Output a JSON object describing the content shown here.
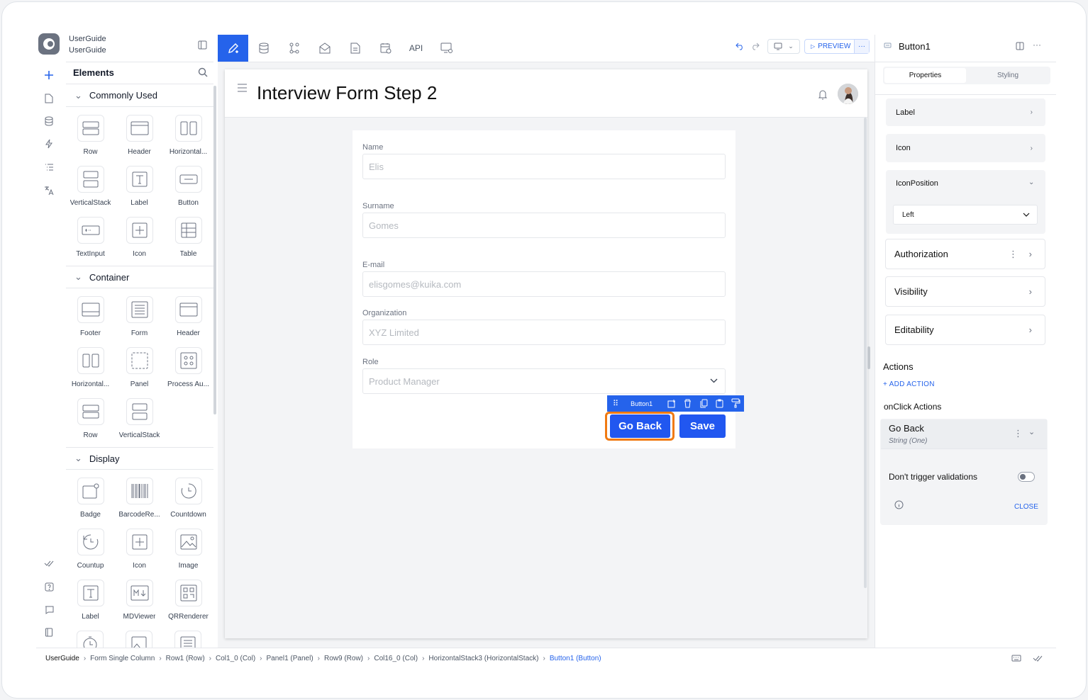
{
  "app": {
    "name_line1": "UserGuide",
    "name_line2": "UserGuide"
  },
  "toolbar": {
    "api_label": "API",
    "preview_label": "PREVIEW"
  },
  "elements_panel": {
    "title": "Elements",
    "sections": [
      {
        "label": "Commonly Used",
        "items": [
          "Row",
          "Header",
          "Horizontal...",
          "VerticalStack",
          "Label",
          "Button",
          "TextInput",
          "Icon",
          "Table"
        ]
      },
      {
        "label": "Container",
        "items": [
          "Footer",
          "Form",
          "Header",
          "Horizontal...",
          "Panel",
          "Process Au...",
          "Row",
          "VerticalStack"
        ]
      },
      {
        "label": "Display",
        "items": [
          "Badge",
          "BarcodeRe...",
          "Countdown",
          "Countup",
          "Icon",
          "Image",
          "Label",
          "MDViewer",
          "QRRenderer"
        ]
      }
    ]
  },
  "page": {
    "title": "Interview Form Step 2",
    "fields": [
      {
        "label": "Name",
        "placeholder": "Elis"
      },
      {
        "label": "Surname",
        "placeholder": "Gomes"
      },
      {
        "label": "E-mail",
        "placeholder": "elisgomes@kuika.com"
      },
      {
        "label": "Organization",
        "placeholder": "XYZ Limited"
      },
      {
        "label": "Role",
        "placeholder": "Product Manager"
      }
    ],
    "selection_label": "Button1",
    "go_back_label": "Go Back",
    "save_label": "Save"
  },
  "properties_panel": {
    "component_name": "Button1",
    "tab_properties": "Properties",
    "tab_styling": "Styling",
    "label_row": "Label",
    "icon_row": "Icon",
    "icon_position_label": "IconPosition",
    "icon_position_value": "Left",
    "authorization": "Authorization",
    "visibility": "Visibility",
    "editability": "Editability",
    "actions_title": "Actions",
    "add_action": "+ ADD ACTION",
    "onclick_title": "onClick Actions",
    "action_name": "Go Back",
    "action_type": "String (One)",
    "dont_trigger": "Don't trigger validations",
    "dont_trigger_on": false,
    "close_label": "CLOSE"
  },
  "breadcrumb": [
    "UserGuide",
    "Form Single Column",
    "Row1 (Row)",
    "Col1_0 (Col)",
    "Panel1 (Panel)",
    "Row9 (Row)",
    "Col16_0 (Col)",
    "HorizontalStack3 (HorizontalStack)",
    "Button1 (Button)"
  ],
  "colors": {
    "accent": "#2563eb",
    "highlight": "#f07a12"
  }
}
